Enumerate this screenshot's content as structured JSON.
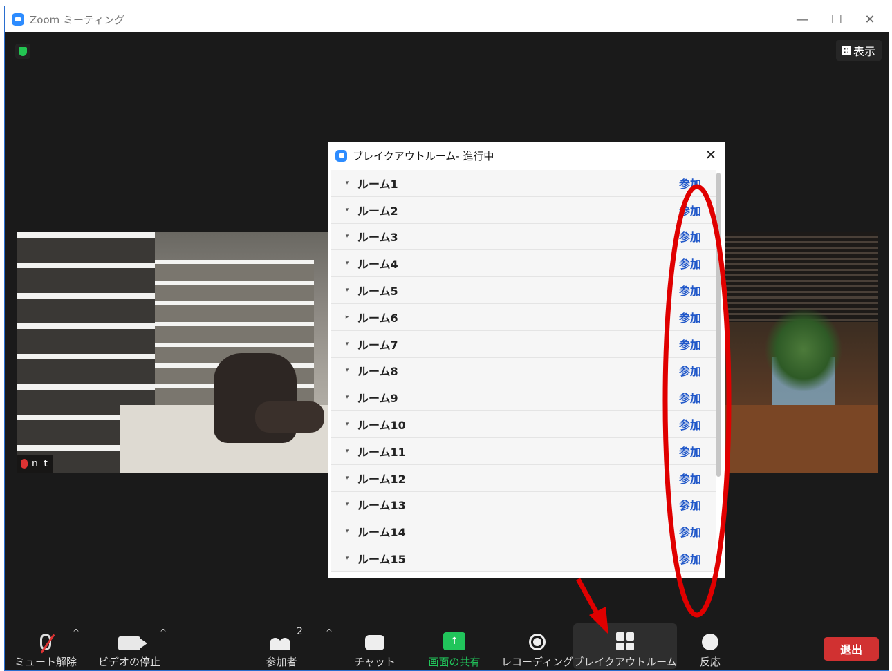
{
  "window": {
    "title": "Zoom ミーティング",
    "minimize": "—",
    "maximize": "☐",
    "close": "✕"
  },
  "meeting": {
    "view_button": "表示",
    "left_participant": {
      "name": "n t"
    }
  },
  "dialog": {
    "title": "ブレイクアウトルーム- 進行中",
    "close": "✕",
    "join_label": "参加",
    "rooms": [
      {
        "name": "ルーム1",
        "caret": "▾"
      },
      {
        "name": "ルーム2",
        "caret": "▾"
      },
      {
        "name": "ルーム3",
        "caret": "▾"
      },
      {
        "name": "ルーム4",
        "caret": "▾"
      },
      {
        "name": "ルーム5",
        "caret": "▾"
      },
      {
        "name": "ルーム6",
        "caret": "▸"
      },
      {
        "name": "ルーム7",
        "caret": "▾"
      },
      {
        "name": "ルーム8",
        "caret": "▾"
      },
      {
        "name": "ルーム9",
        "caret": "▾"
      },
      {
        "name": "ルーム10",
        "caret": "▾"
      },
      {
        "name": "ルーム11",
        "caret": "▾"
      },
      {
        "name": "ルーム12",
        "caret": "▾"
      },
      {
        "name": "ルーム13",
        "caret": "▾"
      },
      {
        "name": "ルーム14",
        "caret": "▾"
      },
      {
        "name": "ルーム15",
        "caret": "▾"
      }
    ]
  },
  "toolbar": {
    "unmute": "ミュート解除",
    "stop_video": "ビデオの停止",
    "participants": "参加者",
    "participant_count": "2",
    "chat": "チャット",
    "share_screen": "画面の共有",
    "recording": "レコーディング",
    "breakout_rooms": "ブレイクアウトルーム",
    "reactions": "反応",
    "leave": "退出",
    "caret": "^"
  },
  "colors": {
    "accent_blue": "#2d8cff",
    "join_link": "#2158c9",
    "share_green": "#21c55b",
    "leave_red": "#d13131",
    "annotation_red": "#e00000"
  }
}
